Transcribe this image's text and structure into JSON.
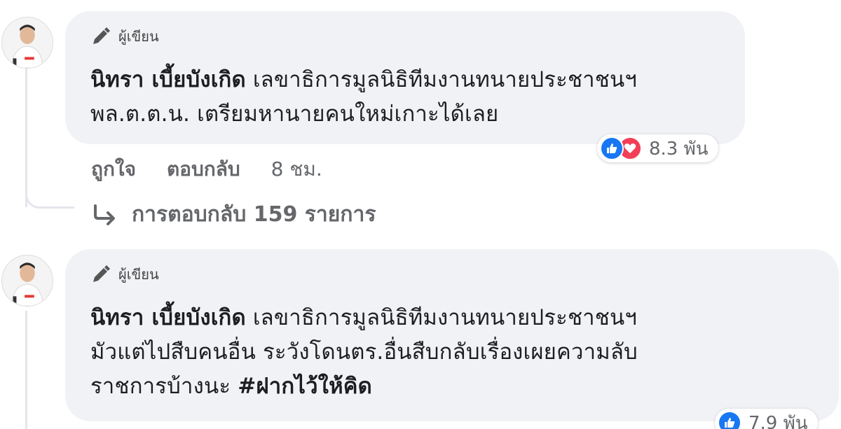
{
  "comments": [
    {
      "badge": "ผู้เขียน",
      "author": "นิทรา เบี้ยบังเกิด",
      "text": " เลขาธิการมูลนิธิทีมงานทนายประชาชนฯ\nพล.ต.ต.น. เตรียมหานายคนใหม่เกาะได้เลย",
      "reaction_count": "8.3 พัน",
      "reaction_icons": [
        "like-icon",
        "love-icon"
      ],
      "actions": {
        "like": "ถูกใจ",
        "reply": "ตอบกลับ",
        "time": "8 ชม."
      },
      "replies_label": "การตอบกลับ 159 รายการ"
    },
    {
      "badge": "ผู้เขียน",
      "author": "นิทรา เบี้ยบังเกิด",
      "text": " เลขาธิการมูลนิธิทีมงานทนายประชาชนฯ\nมัวแต่ไปสืบคนอื่น ระวังโดนตร.อื่นสืบกลับเรื่องเผยความลับ\nราชการบ้างนะ ",
      "hashtag": "#ฝากไว้ให้คิด",
      "reaction_count": "7.9 พัน",
      "reaction_icons": [
        "like-icon"
      ]
    }
  ],
  "colors": {
    "bubble": "#f0f2f5",
    "secondary_text": "#65676b",
    "like": "#1877f2",
    "love": "#f33e58"
  }
}
